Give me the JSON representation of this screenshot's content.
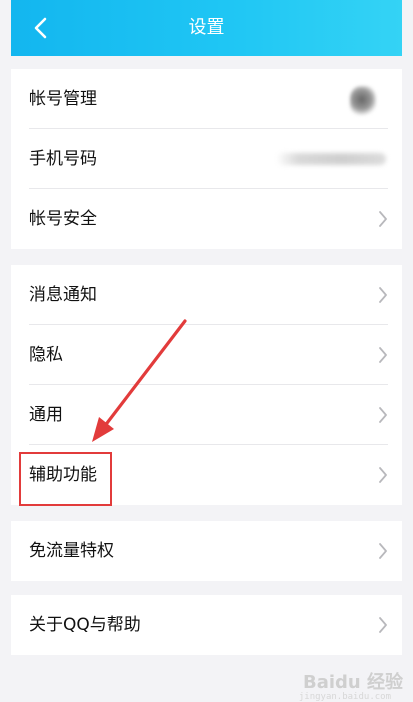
{
  "header": {
    "title": "设置"
  },
  "groups": [
    {
      "items": [
        {
          "label": "帐号管理"
        },
        {
          "label": "手机号码"
        },
        {
          "label": "帐号安全"
        }
      ]
    },
    {
      "items": [
        {
          "label": "消息通知"
        },
        {
          "label": "隐私"
        },
        {
          "label": "通用"
        },
        {
          "label": "辅助功能"
        }
      ]
    },
    {
      "items": [
        {
          "label": "免流量特权"
        }
      ]
    },
    {
      "items": [
        {
          "label": "关于QQ与帮助"
        }
      ]
    }
  ],
  "watermark": {
    "text": "Baidu 经验",
    "sub": "jingyan.baidu.com"
  },
  "colors": {
    "header_gradient_start": "#13b6ef",
    "header_gradient_end": "#34d3f5",
    "annotation_red": "#e23b3b",
    "background": "#f3f3f6"
  }
}
